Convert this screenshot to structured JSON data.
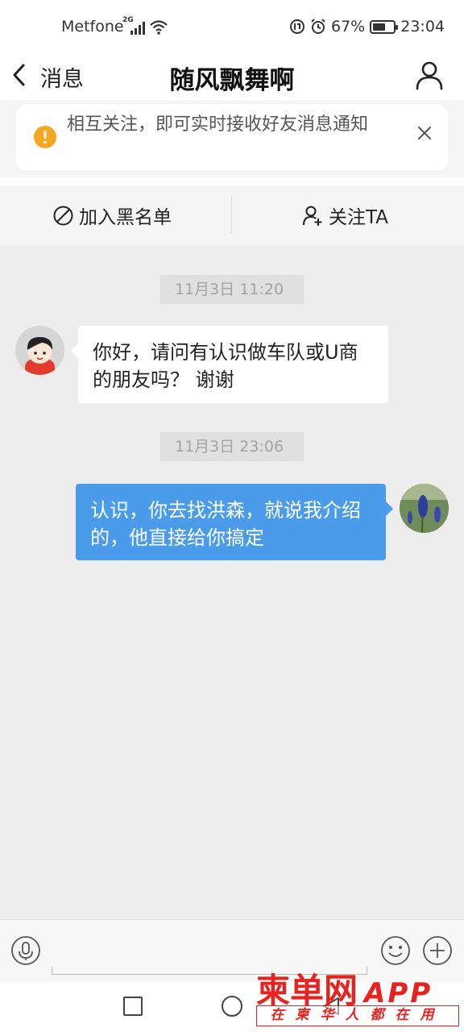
{
  "status_bar": {
    "carrier": "Metfone",
    "network_tag": "2G",
    "battery": "67%",
    "battery_level": 0.67,
    "time": "23:04"
  },
  "nav": {
    "back_label": "消息",
    "title": "随风飘舞啊",
    "profile_icon": "person-outline-icon"
  },
  "notice": {
    "text": "相互关注，即可实时接收好友消息通知",
    "accent_color": "#f5a623"
  },
  "actions": {
    "block_label": "加入黑名单",
    "follow_label": "关注TA"
  },
  "messages": [
    {
      "timestamp": "11月3日 11:20",
      "direction": "incoming",
      "text": "你好，请问有认识做车队或U商的朋友吗？ 谢谢"
    },
    {
      "timestamp": "11月3日 23:06",
      "direction": "outgoing",
      "text": "认识，你去找洪森，就说我介绍的，他直接给你搞定"
    }
  ],
  "colors": {
    "outgoing_bubble": "#4a9cea",
    "incoming_bubble": "#ffffff",
    "chat_background": "#ededed",
    "watermark": "#e8231f"
  },
  "watermark": {
    "brand": "柬单网",
    "app": "APP",
    "slogan": "在柬华人都在用"
  }
}
